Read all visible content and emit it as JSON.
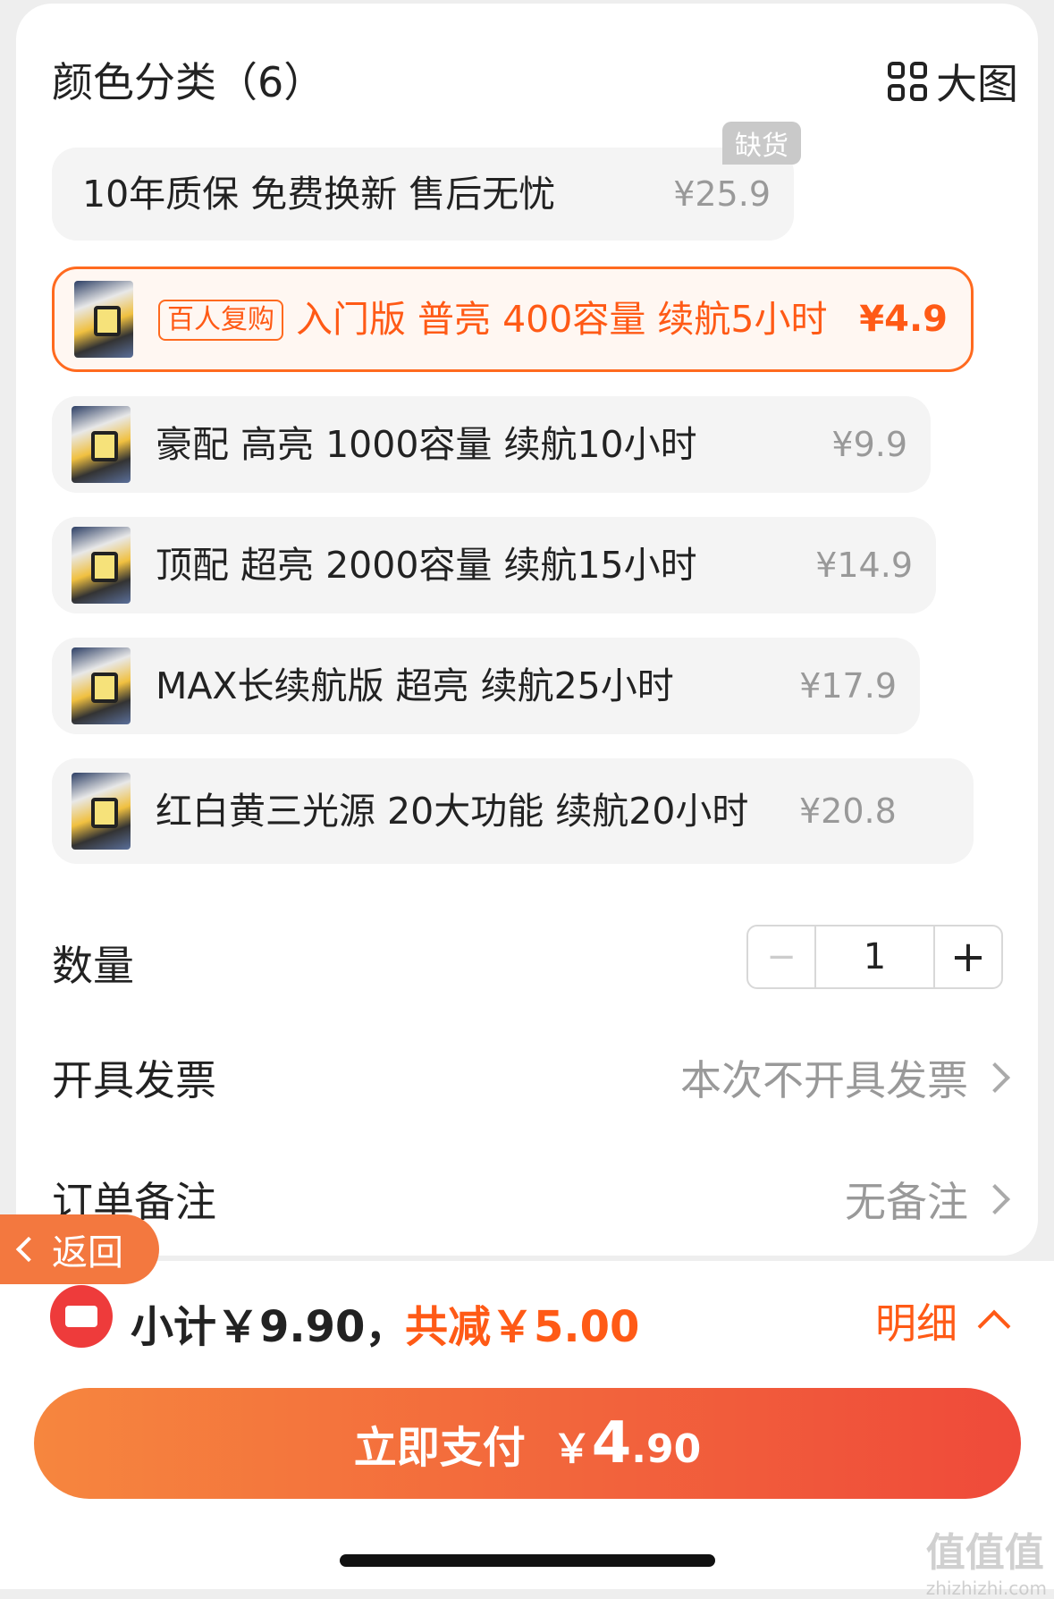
{
  "header": {
    "title": "颜色分类（6）",
    "big_view_label": "大图"
  },
  "options": [
    {
      "label": "10年质保 免费换新  售后无忧",
      "price": "¥25.9",
      "badge": "缺货"
    },
    {
      "tag": "百人复购",
      "label": "入门版 普亮 400容量 续航5小时",
      "price": "¥4.9"
    },
    {
      "label": "豪配 高亮 1000容量 续航10小时",
      "price": "¥9.9"
    },
    {
      "label": "顶配 超亮 2000容量 续航15小时",
      "price": "¥14.9"
    },
    {
      "label": "MAX长续航版 超亮 续航25小时",
      "price": "¥17.9"
    },
    {
      "label": "红白黄三光源 20大功能  续航20小时",
      "price": "¥20.8"
    }
  ],
  "quantity": {
    "label": "数量",
    "minus": "−",
    "value": "1",
    "plus": "+"
  },
  "invoice": {
    "label": "开具发票",
    "value": "本次不开具发票"
  },
  "remark": {
    "label": "订单备注",
    "value": "无备注"
  },
  "back_button": {
    "label": "返回"
  },
  "summary": {
    "subtotal": "小计￥9.90，",
    "discount": "共减￥5.00",
    "detail": "明细"
  },
  "pay": {
    "label": "立即支付",
    "currency": "￥",
    "amount_int": "4",
    "amount_dec": ".90"
  },
  "watermark": {
    "text": "值值值",
    "sub": "zhizhizhi.com"
  },
  "colors": {
    "accent": "#ff5a16",
    "pay_start": "#f6863e",
    "pay_end": "#ef4a3a"
  }
}
